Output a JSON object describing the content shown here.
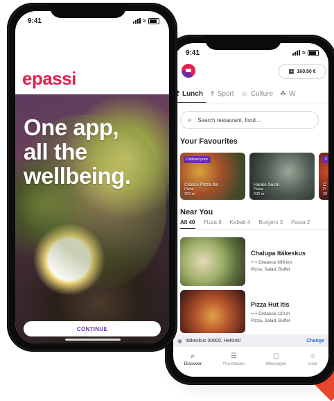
{
  "front_phone": {
    "status_time": "9:41",
    "brand": "epassi",
    "tagline": [
      "One app,",
      "all the",
      "wellbeing."
    ],
    "continue_label": "CONTINUE"
  },
  "back_phone": {
    "status_time": "9:41",
    "balance": "160,50 €",
    "categories": [
      {
        "label": "Lunch",
        "icon": "fork-knife-icon",
        "active": true
      },
      {
        "label": "Sport",
        "icon": "running-icon",
        "active": false
      },
      {
        "label": "Culture",
        "icon": "theater-icon",
        "active": false
      },
      {
        "label": "W",
        "icon": "wellness-icon",
        "active": false
      }
    ],
    "search_placeholder": "Search restaurant, food...",
    "favourites_title": "Your Favourites",
    "favourites": [
      {
        "badge": "Contract price",
        "name": "Classic Pizza Itis",
        "type": "Pizza",
        "distance": "200 m"
      },
      {
        "badge": "",
        "name": "Hanko Sushi",
        "type": "Pizza",
        "distance": "200 m"
      },
      {
        "badge": "C",
        "name": "C",
        "type": "Pi",
        "distance": "20"
      }
    ],
    "near_title": "Near You",
    "filters": [
      {
        "label": "All 40",
        "active": true
      },
      {
        "label": "Pizza 8",
        "active": false
      },
      {
        "label": "Kebab 4",
        "active": false
      },
      {
        "label": "Burgers 3",
        "active": false
      },
      {
        "label": "Pasta 2",
        "active": false
      }
    ],
    "restaurants": [
      {
        "name": "Chalupa Itäkeskus",
        "distance": "Distance 698 km",
        "tags": "Pizza, Salad, Buffet"
      },
      {
        "name": "Pizza Hut Itis",
        "distance": "Distance 120 m",
        "tags": "Pizza, Salad, Buffet"
      }
    ],
    "location": "Itäkeskus 00900, Helsinki",
    "change_label": "Change",
    "tabs": [
      {
        "label": "Discover",
        "icon": "search-icon",
        "active": true
      },
      {
        "label": "Purchases",
        "icon": "list-icon",
        "active": false
      },
      {
        "label": "Messages",
        "icon": "message-icon",
        "active": false
      },
      {
        "label": "User",
        "icon": "user-icon",
        "active": false
      }
    ]
  },
  "colors": {
    "brand_pink": "#e2214f",
    "brand_purple": "#6b2ea3",
    "link_blue": "#2a6fd6"
  }
}
